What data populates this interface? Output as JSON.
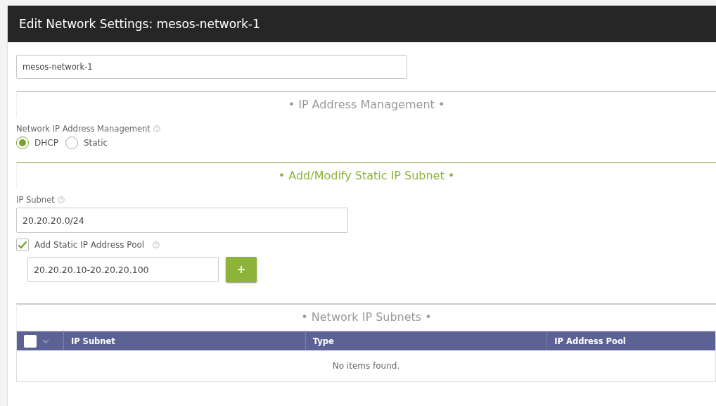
{
  "window": {
    "title": "Edit Network Settings: mesos-network-1"
  },
  "name_field": {
    "value": "mesos-network-1"
  },
  "sections": [
    {
      "heading": "• IP Address Management •",
      "kind": "plain",
      "items": [
        {
          "kind": "radio-group",
          "label": "Network IP Address Management",
          "options": [
            {
              "label": "DHCP",
              "selected": true
            },
            {
              "label": "Static",
              "selected": false
            }
          ]
        }
      ]
    },
    {
      "heading": "• Add/Modify Static IP Subnet •",
      "kind": "accent",
      "items": [
        {
          "kind": "text-field",
          "label": "IP Subnet",
          "value": "20.20.20.0/24"
        },
        {
          "kind": "checkbox",
          "label": "Add Static IP Address Pool",
          "checked": true
        },
        {
          "kind": "pool-field",
          "value": "20.20.20.10-20.20.20.100",
          "button": "+"
        }
      ]
    },
    {
      "heading": "• Network IP Subnets •",
      "kind": "plain",
      "items": [
        {
          "kind": "table",
          "select_all": {
            "checked": false
          },
          "columns": [
            "IP Subnet",
            "Type",
            "IP Address Pool"
          ],
          "empty_text": "No items found."
        }
      ]
    }
  ]
}
